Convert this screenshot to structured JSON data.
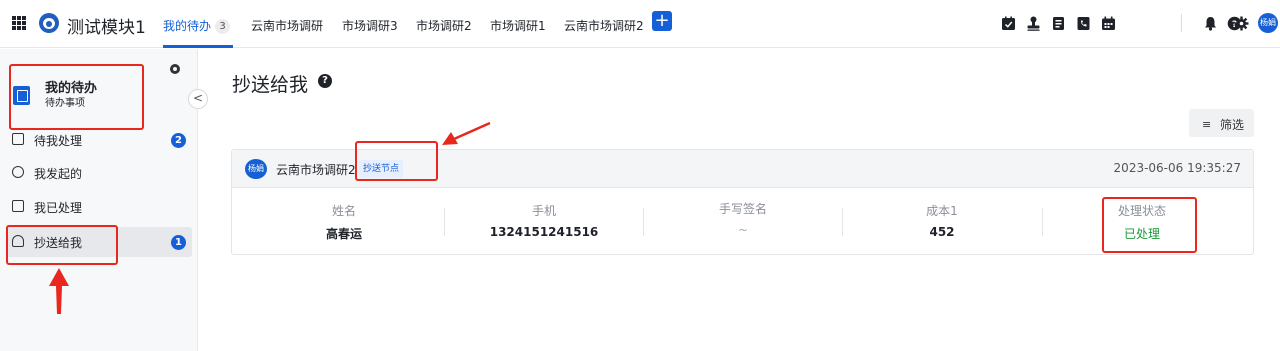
{
  "app": {
    "title": "测试模块1",
    "accent": "#1560d6"
  },
  "tabs": [
    {
      "label": "我的待办",
      "count": "3",
      "active": true
    },
    {
      "label": "云南市场调研"
    },
    {
      "label": "市场调研3"
    },
    {
      "label": "市场调研2"
    },
    {
      "label": "市场调研1"
    },
    {
      "label": "云南市场调研2"
    }
  ],
  "add_tab": "+",
  "toolbar_icons": [
    "checklist-icon",
    "stamp-icon",
    "document-icon",
    "phone-book-icon",
    "calendar-icon",
    "bell-icon",
    "help-icon",
    "gear-icon"
  ],
  "user": {
    "avatar_text": "杨娟"
  },
  "sidebar": {
    "title": "我的待办",
    "subtitle": "待办事项",
    "collapse_glyph": "<",
    "items": [
      {
        "label": "待我处理",
        "badge": "2"
      },
      {
        "label": "我发起的"
      },
      {
        "label": "我已处理"
      },
      {
        "label": "抄送给我",
        "badge": "1",
        "active": true
      }
    ]
  },
  "main": {
    "title": "抄送给我",
    "help_glyph": "?",
    "filter": {
      "icon_glyph": "≡",
      "label": "筛选"
    },
    "card": {
      "avatar_text": "杨娟",
      "form_name": "云南市场调研2",
      "tag": "抄送节点",
      "time": "2023-06-06 19:35:27",
      "fields": [
        {
          "label": "姓名",
          "value": "高春运"
        },
        {
          "label": "手机",
          "value": "13241512415​16"
        },
        {
          "label": "手写签名",
          "value": "~"
        },
        {
          "label": "成本1",
          "value": "452"
        },
        {
          "label": "处理状态",
          "value": "已处理",
          "status_color": "#1a9a3a"
        }
      ]
    }
  },
  "annotation_color": "#e8281e"
}
